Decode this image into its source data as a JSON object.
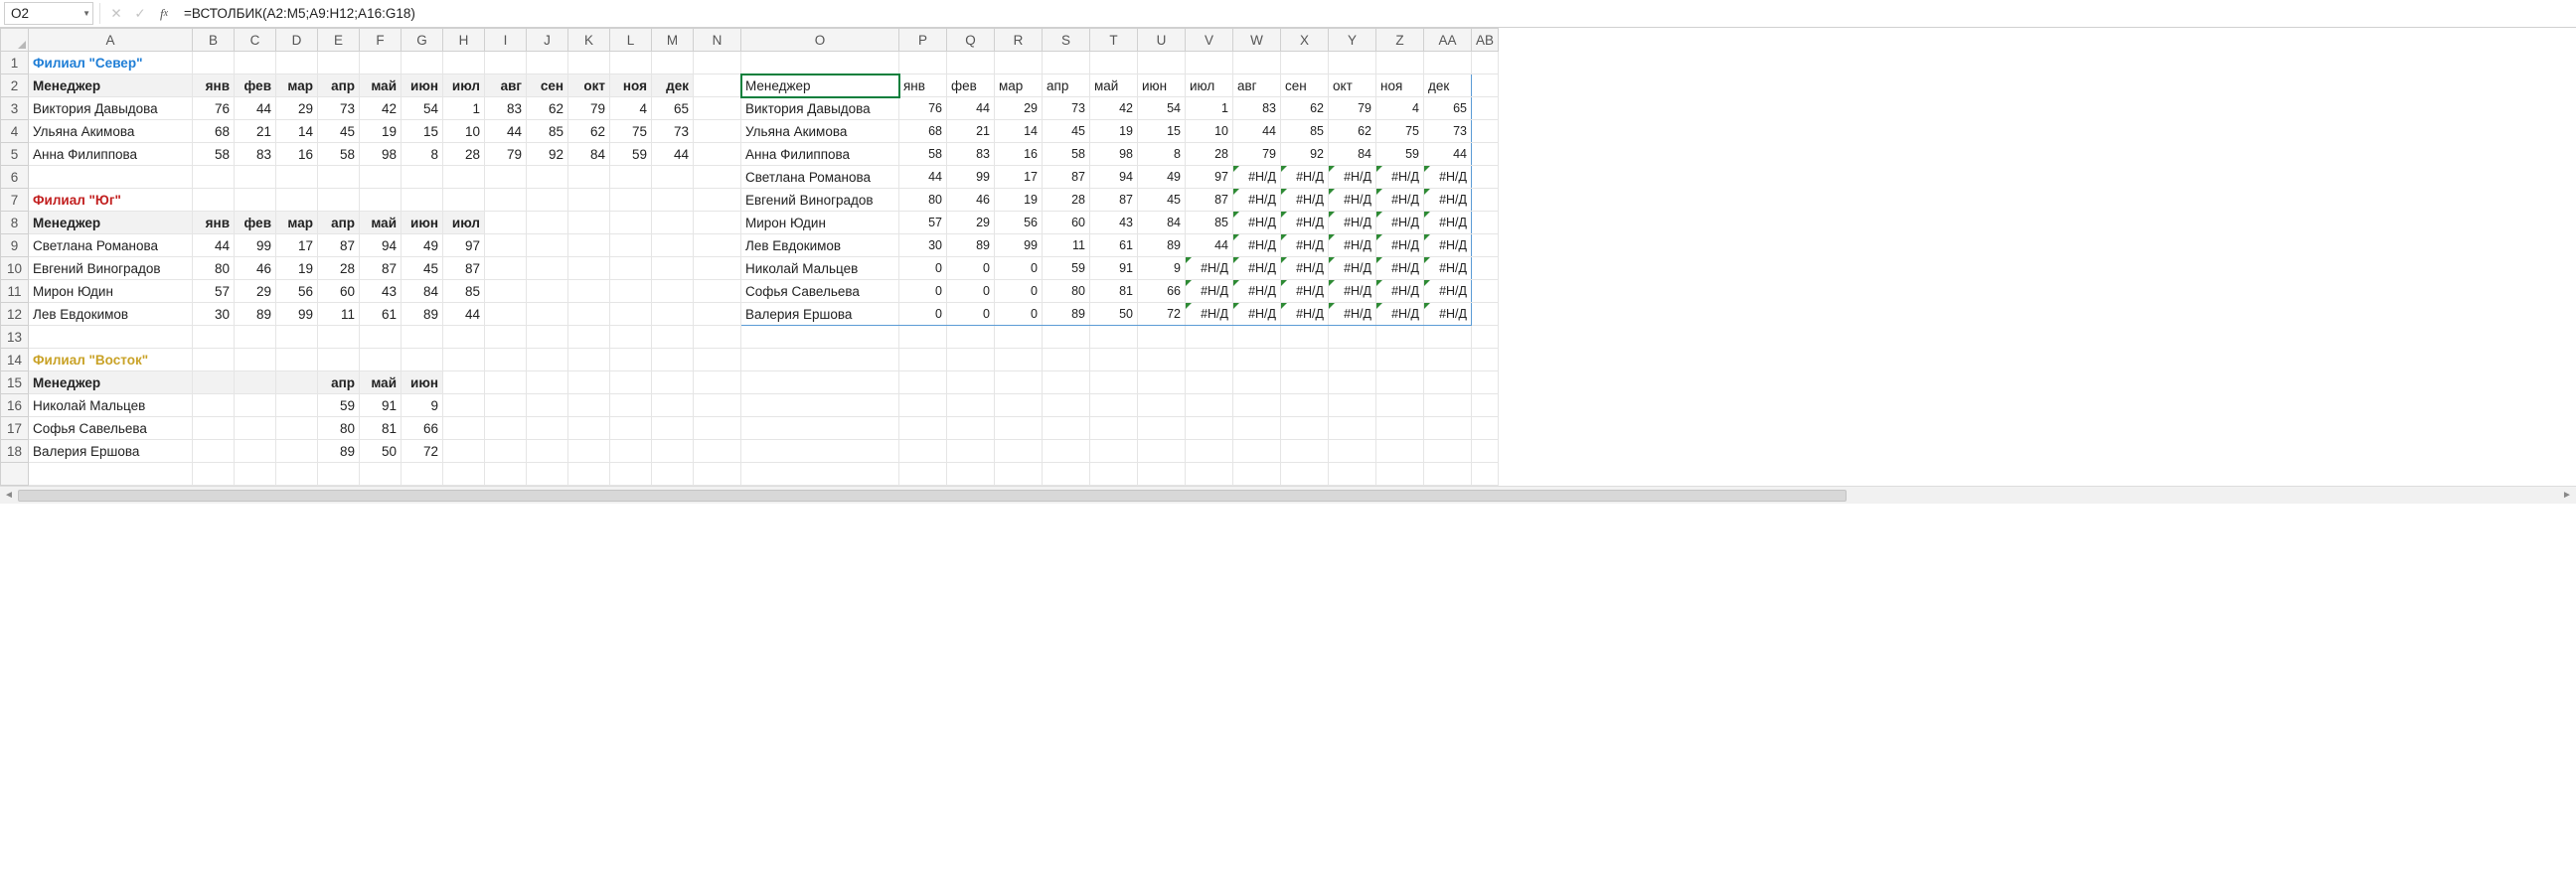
{
  "namebox_value": "O2",
  "formula": "=ВСТОЛБИК(A2:M5;A9:H12;A16:G18)",
  "col_headers": [
    "A",
    "B",
    "C",
    "D",
    "E",
    "F",
    "G",
    "H",
    "I",
    "J",
    "K",
    "L",
    "M",
    "N",
    "O",
    "P",
    "Q",
    "R",
    "S",
    "T",
    "U",
    "V",
    "W",
    "X",
    "Y",
    "Z",
    "AA",
    "AB"
  ],
  "row_count": 18,
  "left": {
    "title1": "Филиал \"Север\"",
    "title2": "Филиал \"Юг\"",
    "title3": "Филиал \"Восток\"",
    "mgr_label": "Менеджер",
    "months12": [
      "янв",
      "фев",
      "мар",
      "апр",
      "май",
      "июн",
      "июл",
      "авг",
      "сен",
      "окт",
      "ноя",
      "дек"
    ],
    "months7": [
      "янв",
      "фев",
      "мар",
      "апр",
      "май",
      "июн",
      "июл"
    ],
    "months3": [
      "апр",
      "май",
      "июн"
    ],
    "north": [
      {
        "name": "Виктория Давыдова",
        "v": [
          76,
          44,
          29,
          73,
          42,
          54,
          1,
          83,
          62,
          79,
          4,
          65
        ]
      },
      {
        "name": "Ульяна Акимова",
        "v": [
          68,
          21,
          14,
          45,
          19,
          15,
          10,
          44,
          85,
          62,
          75,
          73
        ]
      },
      {
        "name": "Анна Филиппова",
        "v": [
          58,
          83,
          16,
          58,
          98,
          8,
          28,
          79,
          92,
          84,
          59,
          44
        ]
      }
    ],
    "south": [
      {
        "name": "Светлана Романова",
        "v": [
          44,
          99,
          17,
          87,
          94,
          49,
          97
        ]
      },
      {
        "name": "Евгений Виноградов",
        "v": [
          80,
          46,
          19,
          28,
          87,
          45,
          87
        ]
      },
      {
        "name": "Мирон Юдин",
        "v": [
          57,
          29,
          56,
          60,
          43,
          84,
          85
        ]
      },
      {
        "name": "Лев Евдокимов",
        "v": [
          30,
          89,
          99,
          11,
          61,
          89,
          44
        ]
      }
    ],
    "east": [
      {
        "name": "Николай Мальцев",
        "v": [
          59,
          91,
          9
        ]
      },
      {
        "name": "Софья Савельева",
        "v": [
          80,
          81,
          66
        ]
      },
      {
        "name": "Валерия Ершова",
        "v": [
          89,
          50,
          72
        ]
      }
    ]
  },
  "right": {
    "mgr_label": "Менеджер",
    "months12": [
      "янв",
      "фев",
      "мар",
      "апр",
      "май",
      "июн",
      "июл",
      "авг",
      "сен",
      "окт",
      "ноя",
      "дек"
    ],
    "rows": [
      {
        "name": "Виктория Давыдова",
        "v": [
          "76",
          "44",
          "29",
          "73",
          "42",
          "54",
          "1",
          "83",
          "62",
          "79",
          "4",
          "65"
        ]
      },
      {
        "name": "Ульяна Акимова",
        "v": [
          "68",
          "21",
          "14",
          "45",
          "19",
          "15",
          "10",
          "44",
          "85",
          "62",
          "75",
          "73"
        ]
      },
      {
        "name": "Анна Филиппова",
        "v": [
          "58",
          "83",
          "16",
          "58",
          "98",
          "8",
          "28",
          "79",
          "92",
          "84",
          "59",
          "44"
        ]
      },
      {
        "name": "Светлана Романова",
        "v": [
          "44",
          "99",
          "17",
          "87",
          "94",
          "49",
          "97",
          "#Н/Д",
          "#Н/Д",
          "#Н/Д",
          "#Н/Д",
          "#Н/Д"
        ]
      },
      {
        "name": "Евгений Виноградов",
        "v": [
          "80",
          "46",
          "19",
          "28",
          "87",
          "45",
          "87",
          "#Н/Д",
          "#Н/Д",
          "#Н/Д",
          "#Н/Д",
          "#Н/Д"
        ]
      },
      {
        "name": "Мирон Юдин",
        "v": [
          "57",
          "29",
          "56",
          "60",
          "43",
          "84",
          "85",
          "#Н/Д",
          "#Н/Д",
          "#Н/Д",
          "#Н/Д",
          "#Н/Д"
        ]
      },
      {
        "name": "Лев Евдокимов",
        "v": [
          "30",
          "89",
          "99",
          "11",
          "61",
          "89",
          "44",
          "#Н/Д",
          "#Н/Д",
          "#Н/Д",
          "#Н/Д",
          "#Н/Д"
        ]
      },
      {
        "name": "Николай Мальцев",
        "v": [
          "0",
          "0",
          "0",
          "59",
          "91",
          "9",
          "#Н/Д",
          "#Н/Д",
          "#Н/Д",
          "#Н/Д",
          "#Н/Д",
          "#Н/Д"
        ]
      },
      {
        "name": "Софья Савельева",
        "v": [
          "0",
          "0",
          "0",
          "80",
          "81",
          "66",
          "#Н/Д",
          "#Н/Д",
          "#Н/Д",
          "#Н/Д",
          "#Н/Д",
          "#Н/Д"
        ]
      },
      {
        "name": "Валерия Ершова",
        "v": [
          "0",
          "0",
          "0",
          "89",
          "50",
          "72",
          "#Н/Д",
          "#Н/Д",
          "#Н/Д",
          "#Н/Д",
          "#Н/Д",
          "#Н/Д"
        ]
      }
    ]
  }
}
